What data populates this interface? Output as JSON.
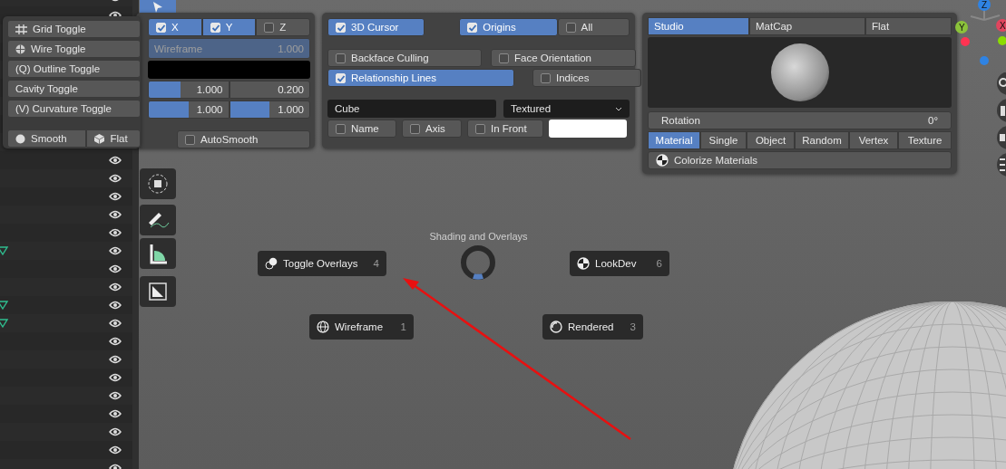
{
  "left_menu": {
    "items": [
      {
        "label": "Grid Toggle"
      },
      {
        "label": "Wire Toggle"
      },
      {
        "label": "(Q) Outline Toggle"
      },
      {
        "label": "Cavity Toggle"
      },
      {
        "label": "(V) Curvature Toggle"
      }
    ],
    "shading_buttons": [
      {
        "label": "Smooth",
        "selected": false
      },
      {
        "label": "Flat",
        "selected": false
      }
    ]
  },
  "overlay_panel": {
    "axes": [
      {
        "label": "X",
        "checked": true
      },
      {
        "label": "Y",
        "checked": true
      },
      {
        "label": "Z",
        "checked": false
      }
    ],
    "wireframe": {
      "label": "Wireframe",
      "value": "1.000",
      "level": 1
    },
    "cavity": [
      {
        "value": "1.000",
        "level": 0.4
      },
      {
        "value": "0.200"
      }
    ],
    "curvature": [
      {
        "value": "1.000",
        "level": 0.5
      },
      {
        "value": "1.000",
        "level": 0.5
      }
    ],
    "autosmooth": {
      "label": "AutoSmooth",
      "checked": false
    }
  },
  "guides_panel": {
    "guides": [
      {
        "label": "3D Cursor",
        "checked": true
      },
      {
        "label": "Origins",
        "checked": true
      },
      {
        "label": "All",
        "checked": false
      }
    ],
    "display": [
      {
        "label": "Backface Culling",
        "checked": false
      },
      {
        "label": "Face Orientation",
        "checked": false
      },
      {
        "label": "Relationship Lines",
        "checked": true
      },
      {
        "label": "Indices",
        "checked": false
      }
    ],
    "object_name": "Cube",
    "texture_mode": "Textured",
    "object_toggles": [
      {
        "label": "Name",
        "checked": false
      },
      {
        "label": "Axis",
        "checked": false
      },
      {
        "label": "In Front",
        "checked": false
      }
    ]
  },
  "shading_panel": {
    "lighting_tabs": [
      {
        "label": "Studio",
        "selected": true
      },
      {
        "label": "MatCap",
        "selected": false
      },
      {
        "label": "Flat",
        "selected": false
      }
    ],
    "rotation": {
      "label": "Rotation",
      "value": "0°"
    },
    "color_tabs": [
      {
        "label": "Material",
        "selected": true
      },
      {
        "label": "Single",
        "selected": false
      },
      {
        "label": "Object",
        "selected": false
      },
      {
        "label": "Random",
        "selected": false
      },
      {
        "label": "Vertex",
        "selected": false
      },
      {
        "label": "Texture",
        "selected": false
      }
    ],
    "colorize": "Colorize Materials"
  },
  "gizmo": {
    "axes": [
      {
        "label": "Z",
        "color": "#2f83e3"
      },
      {
        "label": "Y",
        "color": "#8bc23a"
      },
      {
        "label": "X",
        "color": "#e0455e"
      }
    ]
  },
  "pie_menu": {
    "title": "Shading and Overlays",
    "items": [
      {
        "label": "Toggle Overlays",
        "key": "4"
      },
      {
        "label": "LookDev",
        "key": "6"
      },
      {
        "label": "Wireframe",
        "key": "1"
      },
      {
        "label": "Rendered",
        "key": "3"
      }
    ]
  }
}
